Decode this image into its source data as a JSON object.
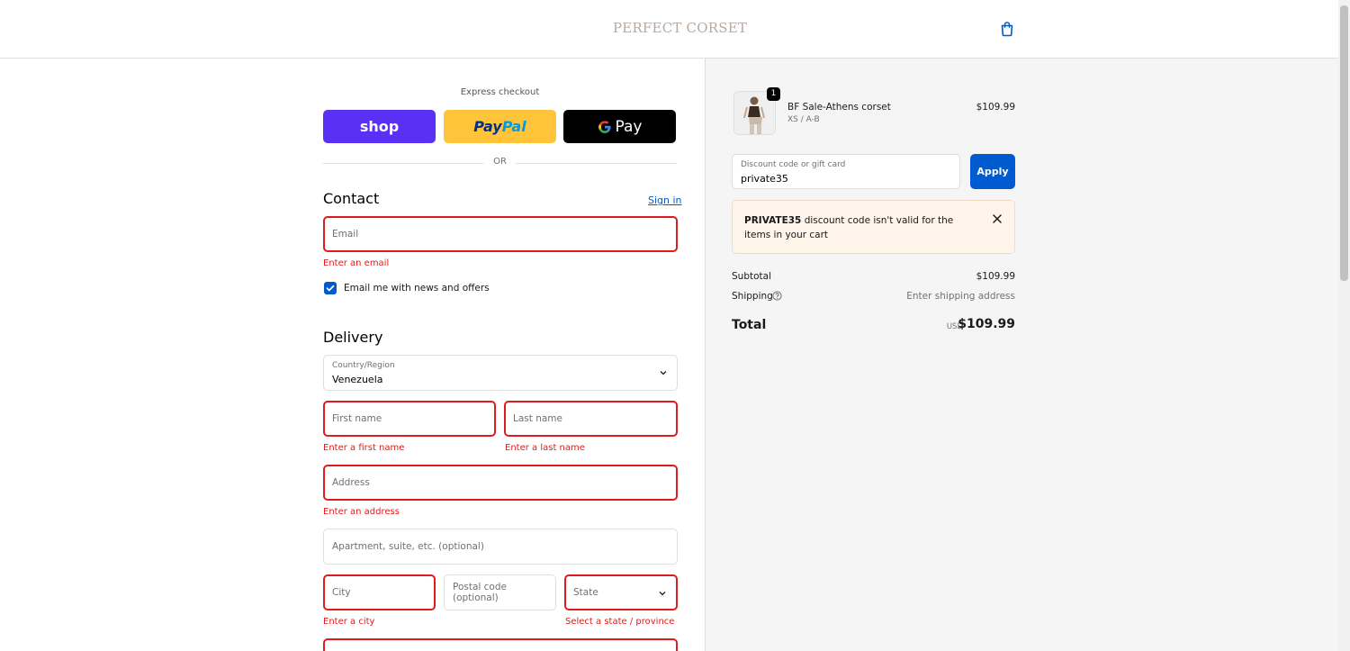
{
  "header": {
    "brand": "PERFECT CORSET",
    "cart_icon": "shopping-bag-icon"
  },
  "express": {
    "label": "Express checkout",
    "shop_label": "shop",
    "paypal_label_1": "Pay",
    "paypal_label_2": "Pal",
    "gpay_label": "Pay",
    "or_label": "OR",
    "colors": {
      "shop": "#5a31f4",
      "paypal": "#ffc439",
      "gpay": "#000000"
    }
  },
  "contact": {
    "title": "Contact",
    "sign_in": "Sign in",
    "email_placeholder": "Email",
    "email_error": "Enter an email",
    "newsletter_label": "Email me with news and offers",
    "newsletter_checked": true
  },
  "delivery": {
    "title": "Delivery",
    "country_label": "Country/Region",
    "country_value": "Venezuela",
    "first_name_placeholder": "First name",
    "first_name_error": "Enter a first name",
    "last_name_placeholder": "Last name",
    "last_name_error": "Enter a last name",
    "address_placeholder": "Address",
    "address_error": "Enter an address",
    "apartment_placeholder": "Apartment, suite, etc. (optional)",
    "city_placeholder": "City",
    "city_error": "Enter a city",
    "postal_placeholder": "Postal code (optional)",
    "state_placeholder": "State",
    "state_error": "Select a state / province"
  },
  "summary": {
    "product": {
      "name": "BF Sale-Athens corset",
      "variant": "XS / A-B",
      "price": "$109.99",
      "quantity": "1"
    },
    "discount": {
      "label": "Discount code or gift card",
      "value": "private35",
      "apply": "Apply"
    },
    "alert": {
      "code": "PRIVATE35",
      "message": " discount code isn't valid for the items in your cart"
    },
    "subtotal_label": "Subtotal",
    "subtotal_value": "$109.99",
    "shipping_label": "Shipping",
    "shipping_value": "Enter shipping address",
    "total_label": "Total",
    "currency": "USD",
    "total_value": "$109.99"
  },
  "colors": {
    "accent": "#005bd1",
    "error": "#dd1d1d",
    "alert_bg": "#fff4ea"
  }
}
